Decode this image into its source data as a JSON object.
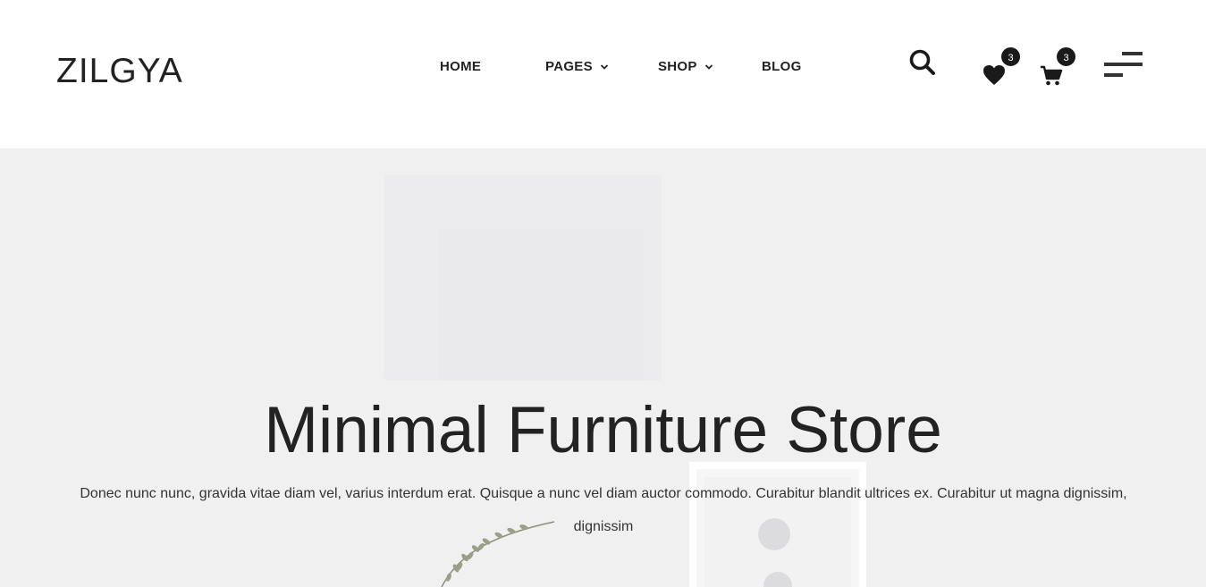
{
  "brand": {
    "logo_text": "ZILGYA"
  },
  "nav": {
    "items": [
      {
        "label": "HOME",
        "has_dropdown": false
      },
      {
        "label": "PAGES",
        "has_dropdown": true
      },
      {
        "label": "SHOP",
        "has_dropdown": true
      },
      {
        "label": "BLOG",
        "has_dropdown": false
      }
    ]
  },
  "header_actions": {
    "search_icon": "search-icon",
    "wishlist": {
      "icon": "heart-icon",
      "count": "3"
    },
    "cart": {
      "icon": "cart-icon",
      "count": "3"
    },
    "menu_icon": "hamburger-menu-icon"
  },
  "hero": {
    "title": "Minimal Furniture Store",
    "description": "Donec nunc nunc, gravida vitae diam vel, varius interdum erat. Quisque a nunc vel diam auctor commodo. Curabitur blandit ultrices ex. Curabitur ut magna dignissim, dignissim"
  },
  "colors": {
    "text": "#222222",
    "hero_background": "#f0f0f1",
    "badge": "#1a1a1a"
  }
}
